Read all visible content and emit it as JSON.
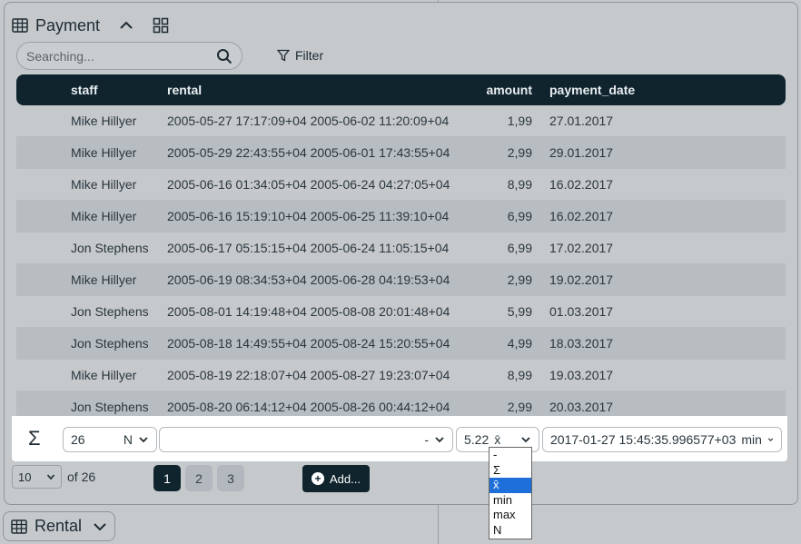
{
  "panel": {
    "title": "Payment",
    "search_placeholder": "Searching...",
    "filter_label": "Filter"
  },
  "table": {
    "columns": [
      "staff",
      "rental",
      "amount",
      "payment_date"
    ],
    "rows": [
      {
        "staff": "Mike Hillyer",
        "rental": "2005-05-27 17:17:09+04 2005-06-02 11:20:09+04",
        "amount": "1,99",
        "payment_date": "27.01.2017"
      },
      {
        "staff": "Mike Hillyer",
        "rental": "2005-05-29 22:43:55+04 2005-06-01 17:43:55+04",
        "amount": "2,99",
        "payment_date": "29.01.2017"
      },
      {
        "staff": "Mike Hillyer",
        "rental": "2005-06-16 01:34:05+04 2005-06-24 04:27:05+04",
        "amount": "8,99",
        "payment_date": "16.02.2017"
      },
      {
        "staff": "Mike Hillyer",
        "rental": "2005-06-16 15:19:10+04 2005-06-25 11:39:10+04",
        "amount": "6,99",
        "payment_date": "16.02.2017"
      },
      {
        "staff": "Jon Stephens",
        "rental": "2005-06-17 05:15:15+04 2005-06-24 11:05:15+04",
        "amount": "6,99",
        "payment_date": "17.02.2017"
      },
      {
        "staff": "Mike Hillyer",
        "rental": "2005-06-19 08:34:53+04 2005-06-28 04:19:53+04",
        "amount": "2,99",
        "payment_date": "19.02.2017"
      },
      {
        "staff": "Jon Stephens",
        "rental": "2005-08-01 14:19:48+04 2005-08-08 20:01:48+04",
        "amount": "5,99",
        "payment_date": "01.03.2017"
      },
      {
        "staff": "Jon Stephens",
        "rental": "2005-08-18 14:49:55+04 2005-08-24 15:20:55+04",
        "amount": "4,99",
        "payment_date": "18.03.2017"
      },
      {
        "staff": "Mike Hillyer",
        "rental": "2005-08-19 22:18:07+04 2005-08-27 19:23:07+04",
        "amount": "8,99",
        "payment_date": "19.03.2017"
      },
      {
        "staff": "Jon Stephens",
        "rental": "2005-08-20 06:14:12+04 2005-08-26 00:44:12+04",
        "amount": "2,99",
        "payment_date": "20.03.2017"
      }
    ]
  },
  "summary": {
    "sigma": "Σ",
    "staff_value": "26",
    "staff_fn": "N",
    "rental_fn": "-",
    "amount_value": "5.22",
    "amount_fn": "x̄",
    "date_value": "2017-01-27 15:45:35.996577+03",
    "date_fn": "min"
  },
  "dropdown_options": [
    "-",
    "Σ",
    "x̄",
    "min",
    "max",
    "N"
  ],
  "dropdown_selected": "x̄",
  "pager": {
    "page_size": "10",
    "of_text": "of 26",
    "pages": [
      "1",
      "2",
      "3"
    ],
    "active_page": "1",
    "add_label": "Add..."
  },
  "rental_tab": {
    "title": "Rental"
  }
}
